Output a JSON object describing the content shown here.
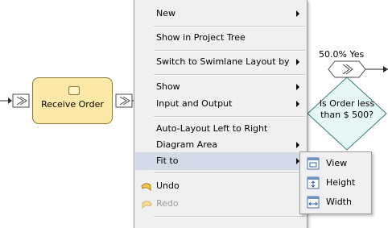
{
  "diagram": {
    "task_label": "Receive Order",
    "gateway_pct": "50.0% Yes",
    "decision_label": "Is Order less than $ 500?"
  },
  "context_menu": {
    "items": [
      {
        "label": "New",
        "submenu": true
      },
      {
        "label": "Show in Project Tree",
        "submenu": false
      },
      {
        "label": "Switch to Swimlane Layout by",
        "submenu": true
      },
      {
        "label": "Show",
        "submenu": true
      },
      {
        "label": "Input and Output",
        "submenu": true
      },
      {
        "label": "Auto-Layout Left to Right",
        "submenu": false
      },
      {
        "label": "Diagram Area",
        "submenu": true
      },
      {
        "label": "Fit to",
        "submenu": true,
        "highlighted": true
      },
      {
        "label": "Undo",
        "icon": "undo-icon"
      },
      {
        "label": "Redo",
        "icon": "redo-icon",
        "disabled": true
      }
    ]
  },
  "fit_to_submenu": {
    "items": [
      {
        "label": "View",
        "icon": "fit-view-icon"
      },
      {
        "label": "Height",
        "icon": "fit-height-icon"
      },
      {
        "label": "Width",
        "icon": "fit-width-icon"
      }
    ]
  },
  "colors": {
    "task_fill": "#fde9a7",
    "menu_bg": "#f0f0f0",
    "highlight": "#d4dbe8",
    "connector": "#2b2b2b"
  }
}
